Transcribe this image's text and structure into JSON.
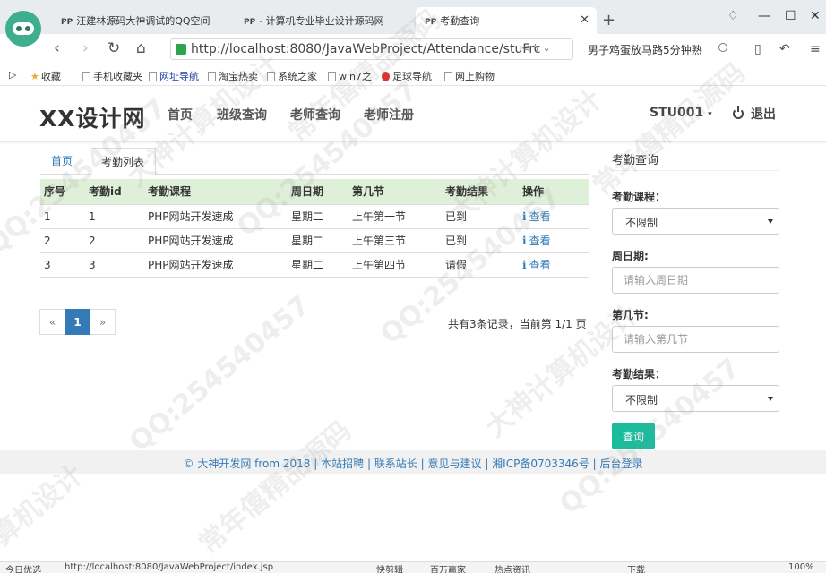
{
  "browser": {
    "tabs": [
      {
        "icon": "PP",
        "title": "汪建林源码大神调试的QQ空间"
      },
      {
        "icon": "PP",
        "title": "- 计算机专业毕业设计源码网"
      },
      {
        "icon": "PP",
        "title": "考勤查询",
        "active": true
      }
    ],
    "new_tab": "+",
    "url": "http://localhost:8080/JavaWebProject/Attendance/stuFrc",
    "search_text": "男子鸡蛋放马路5分钟熟",
    "bookmarks": [
      {
        "label": "收藏",
        "icon": "star-icon"
      },
      {
        "label": "手机收藏夹"
      },
      {
        "label": "网址导航"
      },
      {
        "label": "淘宝热卖"
      },
      {
        "label": "系统之家"
      },
      {
        "label": "win7之"
      },
      {
        "label": "足球导航"
      },
      {
        "label": "网上购物"
      }
    ]
  },
  "header": {
    "brand": "XX设计网",
    "nav": [
      "首页",
      "班级查询",
      "老师查询",
      "老师注册"
    ],
    "user": "STU001",
    "logout": "退出"
  },
  "breadcrumb": {
    "home": "首页",
    "current": "考勤列表"
  },
  "table": {
    "columns": [
      "序号",
      "考勤id",
      "考勤课程",
      "周日期",
      "第几节",
      "考勤结果",
      "操作"
    ],
    "rows": [
      [
        "1",
        "1",
        "PHP网站开发速成",
        "星期二",
        "上午第一节",
        "已到",
        "查看"
      ],
      [
        "2",
        "2",
        "PHP网站开发速成",
        "星期二",
        "上午第三节",
        "已到",
        "查看"
      ],
      [
        "3",
        "3",
        "PHP网站开发速成",
        "星期二",
        "上午第四节",
        "请假",
        "查看"
      ]
    ]
  },
  "pagination": {
    "prev": "«",
    "current": "1",
    "next": "»",
    "info": "共有3条记录，当前第 1/1 页"
  },
  "sidebar": {
    "title": "考勤查询",
    "course_label": "考勤课程：",
    "course_value": "不限制",
    "week_label": "周日期:",
    "week_placeholder": "请输入周日期",
    "section_label": "第几节:",
    "section_placeholder": "请输入第几节",
    "result_label": "考勤结果：",
    "result_value": "不限制",
    "query_button": "查询"
  },
  "footer": {
    "copyright": "© 大神开发网 from 2018",
    "links": [
      "本站招聘",
      "联系站长",
      "意见与建议",
      "湘ICP备0703346号",
      "后台登录"
    ]
  },
  "statusbar": {
    "left": "今日优选",
    "url": "http://localhost:8080/JavaWebProject/index.jsp",
    "items": [
      "快剪辑",
      "百万赢家",
      "热点资讯",
      "下载",
      "100%"
    ]
  },
  "watermarks": [
    "QQ:254540457",
    "大神计算机设计",
    "常年僖精品源码",
    "QQ:254540457",
    "大神计算机设计",
    "常年僖精品源码",
    "QQ:254540457",
    "算机设计",
    "常年僖精品源码",
    "QQ:254540457",
    "大神计算机设计",
    "QQ:254540457"
  ]
}
